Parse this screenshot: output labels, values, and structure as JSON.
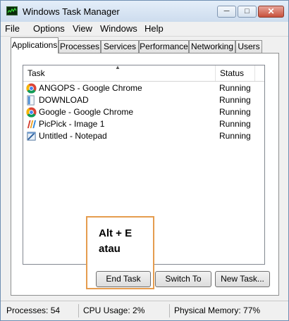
{
  "window": {
    "title": "Windows Task Manager",
    "icon": "task-manager-graph-icon",
    "controls": {
      "minimize": "─",
      "maximize": "□",
      "close": "✕"
    }
  },
  "menu": [
    "File",
    "Options",
    "View",
    "Windows",
    "Help"
  ],
  "tabs": [
    "Applications",
    "Processes",
    "Services",
    "Performance",
    "Networking",
    "Users"
  ],
  "active_tab": "Applications",
  "task_list": {
    "columns": {
      "task": "Task",
      "status": "Status"
    },
    "sort_indicator": "▲",
    "rows": [
      {
        "task": "ANGOPS - Google Chrome",
        "status": "Running",
        "icon": "chrome-icon"
      },
      {
        "task": "DOWNLOAD",
        "status": "Running",
        "icon": "folder-icon"
      },
      {
        "task": "Google - Google Chrome",
        "status": "Running",
        "icon": "chrome-icon"
      },
      {
        "task": "PicPick - Image 1",
        "status": "Running",
        "icon": "picpick-icon"
      },
      {
        "task": "Untitled - Notepad",
        "status": "Running",
        "icon": "notepad-icon"
      }
    ]
  },
  "buttons": {
    "end_task": "End Task",
    "switch_to": "Switch To",
    "new_task": "New Task..."
  },
  "annotation": {
    "text": "Alt + E\natau",
    "color": "#e59c4e"
  },
  "statusbar": {
    "processes": "Processes: 54",
    "cpu": "CPU Usage: 2%",
    "memory": "Physical Memory: 77%"
  }
}
